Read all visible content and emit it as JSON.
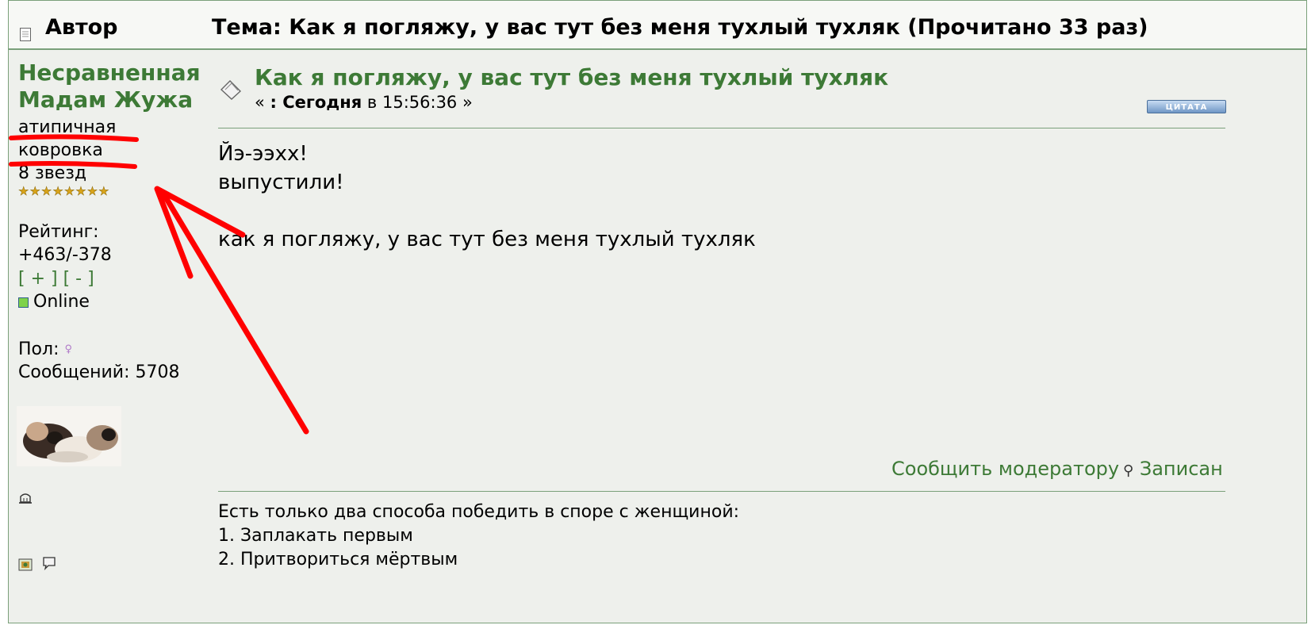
{
  "header": {
    "author_label": "Автор",
    "topic_label": "Тема: Как я погляжу, у вас тут без меня тухлый тухляк  (Прочитано 33 раз)"
  },
  "user": {
    "name_line1": "Несравненная",
    "name_line2": "Мадам Жужа",
    "title_line1": "атипичная",
    "title_line2": "ковровка",
    "stars_label": "8 звезд",
    "star_count": 8,
    "rating_label": "Рейтинг:",
    "rating_value": "+463/-378",
    "rate_plus": "[ + ]",
    "rate_minus": "[ - ]",
    "status": "Online",
    "gender_label": "Пол:",
    "posts_label": "Сообщений: 5708"
  },
  "post": {
    "title": "Как я погляжу, у вас тут без меня тухлый тухляк",
    "date_prefix": "« ",
    "date_bold": ": Сегодня",
    "date_rest": " в 15:56:36 »",
    "quote_label": "ЦИТАТА",
    "body": [
      "Йэ-ээхх!",
      "выпустили!",
      "",
      "как я погляжу, у вас тут без меня тухлый тухляк"
    ],
    "report_link": "Сообщить модератору",
    "logged_label": "Записан",
    "signature": [
      "Есть только два способа победить в споре с женщиной:",
      "1. Заплакать первым",
      "2. Притвориться мёртвым"
    ]
  },
  "colors": {
    "accent_green": "#3d7a36",
    "annotation_red": "#ff0000",
    "border_green": "#7aa07a"
  },
  "icons": [
    "document-icon",
    "post-icon",
    "female-icon",
    "online-icon",
    "profile-icon",
    "www-icon",
    "pm-icon",
    "ip-icon"
  ]
}
